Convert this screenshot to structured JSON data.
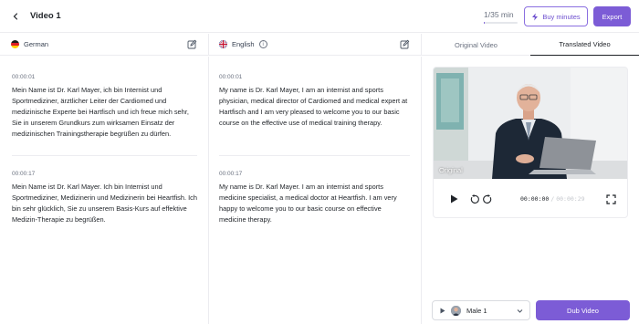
{
  "header": {
    "title": "Video 1",
    "minutes": "1/35 min",
    "minutes_fraction": 0.03,
    "buy_label": "Buy minutes",
    "export_label": "Export"
  },
  "source": {
    "language": "German",
    "segments": [
      {
        "time": "00:00:01",
        "text": "Mein Name ist Dr. Karl Mayer, ich bin Internist und Sportmediziner, ärztlicher Leiter der Cardiomed und medizinische Experte bei Hartfisch und ich freue mich sehr, Sie in unserem Grundkurs zum wirksamen Einsatz der medizinischen Trainingstherapie begrüßen zu dürfen."
      },
      {
        "time": "00:00:17",
        "text": "Mein Name ist Dr. Karl Mayer. Ich bin Internist und Sportmediziner, Medizinerin und Medizinerin bei Heartfish. Ich bin sehr glücklich, Sie zu unserem Basis-Kurs auf effektive Medizin-Therapie zu begrüßen."
      }
    ]
  },
  "target": {
    "language": "English",
    "segments": [
      {
        "time": "00:00:01",
        "text": "My name is Dr. Karl Mayer, I am an internist and sports physician, medical director of Cardiomed and medical expert at Hartfisch and I am very pleased to welcome you to our basic course on the effective use of medical training therapy."
      },
      {
        "time": "00:00:17",
        "text": "My name is Dr. Karl Mayer. I am an internist and sports medicine specialist, a medical doctor at Heartfish. I am very happy to welcome you to our basic course on effective medicine therapy."
      }
    ]
  },
  "tabs": [
    "Original Video",
    "Translated Video"
  ],
  "player": {
    "overlay_label": "Original",
    "current_time": "00:00:00",
    "separator": "/",
    "total_time": "00:00:29"
  },
  "footer": {
    "voice": "Male 1",
    "dub_label": "Dub Video"
  },
  "colors": {
    "accent": "#7c5cd6"
  },
  "icons": [
    "back-icon",
    "lightning-icon",
    "edit-icon",
    "info-icon",
    "play-icon",
    "rewind-icon",
    "forward-icon",
    "fullscreen-icon",
    "chevron-down-icon"
  ]
}
